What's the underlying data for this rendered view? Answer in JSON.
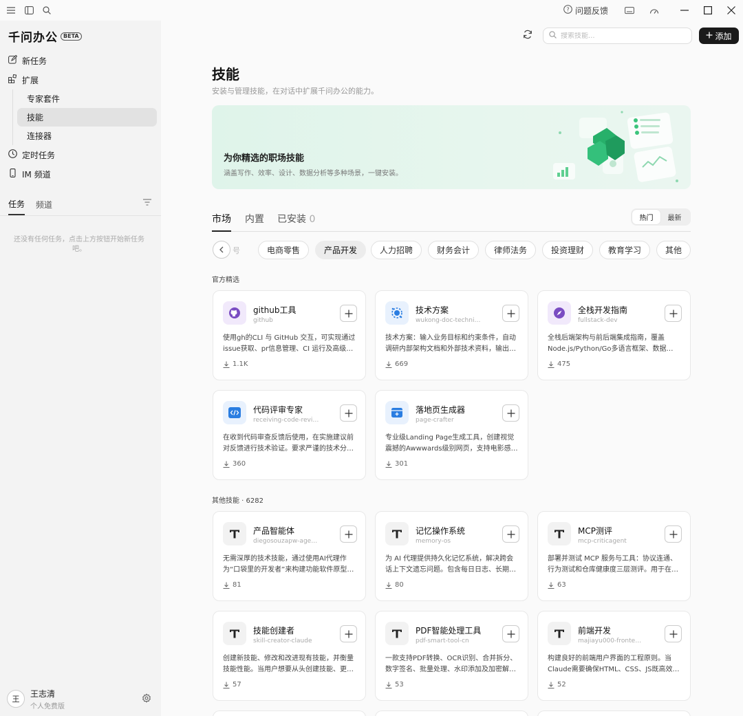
{
  "topbar": {
    "feedback_label": "问题反馈"
  },
  "sidebar": {
    "brand": "千问办公",
    "badge": "BETA",
    "nav": {
      "new_task": "新任务",
      "extensions": "扩展",
      "expert_kits": "专家套件",
      "skills": "技能",
      "connectors": "连接器",
      "scheduled": "定时任务",
      "im_channels": "IM 频道"
    },
    "tabs": {
      "tasks": "任务",
      "channels": "频道"
    },
    "empty_tip": "还没有任何任务，点击上方按钮开始新任务吧。",
    "user": {
      "avatar": "王",
      "name": "王志清",
      "plan": "个人免费版"
    }
  },
  "header": {
    "search_placeholder": "搜索技能...",
    "add_label": "添加"
  },
  "page": {
    "title": "技能",
    "subtitle": "安装与管理技能，在对话中扩展千问办公的能力。"
  },
  "banner": {
    "title": "为你精选的职场技能",
    "subtitle": "涵盖写作、效率、设计、数据分析等多种场景，一键安装。"
  },
  "tabs": {
    "market": "市场",
    "builtin": "内置",
    "installed": "已安装",
    "installed_count": "0"
  },
  "sort": {
    "hot": "热门",
    "newest": "最新"
  },
  "categories": {
    "partial": "号",
    "items": [
      "电商零售",
      "产品开发",
      "人力招聘",
      "财务会计",
      "律师法务",
      "投资理财",
      "教育学习",
      "其他"
    ],
    "selected": "产品开发"
  },
  "official": {
    "label": "官方精选",
    "cards": [
      {
        "name": "github工具",
        "id": "github",
        "desc": "使用gh的CLI 与 GitHub 交互，可实现通过issue获取、pr信息管理、CI 运行及高级…",
        "downloads": "1.1K",
        "icon": "github-icon",
        "color": "#7a4cc2",
        "bg": "#f1e9fb"
      },
      {
        "name": "技术方案",
        "id": "wukong-doc-technical-s…",
        "desc": "技术方案：输入业务目标和约束条件，自动调研内部架构文档和外部技术资料，输出…",
        "downloads": "669",
        "icon": "tech-plan-icon",
        "color": "#2a7de1",
        "bg": "#e8f1fd"
      },
      {
        "name": "全栈开发指南",
        "id": "fullstack-dev",
        "desc": "全栈后端架构与前后端集成指南，覆盖Node.js/Python/Go多语言框架、数据…",
        "downloads": "475",
        "icon": "compass-icon",
        "color": "#7a4cc2",
        "bg": "#f1e9fb"
      },
      {
        "name": "代码评审专家",
        "id": "receiving-code-review",
        "desc": "在收到代码审查反馈后使用，在实施建议前对反馈进行技术验证。要求严谨的技术分…",
        "downloads": "360",
        "icon": "code-review-icon",
        "color": "#2a7de1",
        "bg": "#e8f1fd"
      },
      {
        "name": "落地页生成器",
        "id": "page-crafter",
        "desc": "专业级Landing Page生成工具，创建视觉震撼的Awwwards级别网页，支持电影感…",
        "downloads": "301",
        "icon": "landing-page-icon",
        "color": "#2a7de1",
        "bg": "#e8f1fd"
      }
    ]
  },
  "others": {
    "label": "其他技能 · 6282",
    "cards": [
      {
        "name": "产品智能体",
        "id": "diegosouzapw-agentic-p…",
        "desc": "无需深厚的技术技能，通过使用AI代理作为“口袋里的开发者”来构建功能软件原型…",
        "downloads": "81",
        "icon": "skill-t-icon"
      },
      {
        "name": "记忆操作系统",
        "id": "memory-os",
        "desc": "为 AI 代理提供持久化记忆系统，解决跨会话上下文遗忘问题。包含每日日志、长期…",
        "downloads": "80",
        "icon": "skill-t-icon"
      },
      {
        "name": "MCP测评",
        "id": "mcp-criticagent",
        "desc": "部署并测试 MCP 服务与工具：协议连通、行为测试和仓库健康度三层测评。用于在…",
        "downloads": "63",
        "icon": "skill-t-icon"
      },
      {
        "name": "技能创建者",
        "id": "skill-creator-claude",
        "desc": "创建新技能、修改和改进现有技能，并衡量技能性能。当用户想要从头创建技能、更…",
        "downloads": "57",
        "icon": "skill-t-icon"
      },
      {
        "name": "PDF智能处理工具",
        "id": "pdf-smart-tool-cn",
        "desc": "一款支持PDF转换、OCR识别、合并拆分、数字签名、批量处理、水印添加及加密解…",
        "downloads": "53",
        "icon": "skill-t-icon"
      },
      {
        "name": "前端开发",
        "id": "majiayu000-frontend-co…",
        "desc": "构建良好的前端用户界面的工程原则。当Claude需要确保HTML、CSS、JS既高效…",
        "downloads": "52",
        "icon": "skill-t-icon"
      }
    ]
  }
}
